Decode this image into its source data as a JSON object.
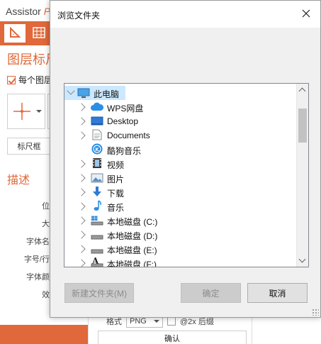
{
  "app": {
    "title_prefix": "Assistor ",
    "title_accent": "P",
    "layers_title": "图层标尺",
    "each_layer_label": "每个图层",
    "ruler_button": "标尺框",
    "desc_title": "描述",
    "props": [
      "位",
      "大",
      "字体名",
      "字号/行",
      "字体颜",
      "效"
    ],
    "format_label": "格式",
    "format_value": "PNG",
    "suffix_label": "@2x 后缀",
    "confirm_label": "确认",
    "accent_color": "#e0683a"
  },
  "dialog": {
    "title": "浏览文件夹",
    "tree": {
      "root": {
        "label": "此电脑",
        "icon": "computer-icon"
      },
      "items": [
        {
          "label": "WPS网盘",
          "icon": "cloud-icon"
        },
        {
          "label": "Desktop",
          "icon": "desktop-icon"
        },
        {
          "label": "Documents",
          "icon": "document-icon"
        },
        {
          "label": "酷狗音乐",
          "icon": "kugou-icon"
        },
        {
          "label": "视频",
          "icon": "video-icon"
        },
        {
          "label": "图片",
          "icon": "pictures-icon"
        },
        {
          "label": "下载",
          "icon": "download-icon"
        },
        {
          "label": "音乐",
          "icon": "music-icon"
        },
        {
          "label": "本地磁盘 (C:)",
          "icon": "windows-drive-icon"
        },
        {
          "label": "本地磁盘 (D:)",
          "icon": "drive-icon"
        },
        {
          "label": "本地磁盘 (E:)",
          "icon": "drive-icon"
        },
        {
          "label": "本地磁盘 (F:)",
          "icon": "font-drive-icon"
        }
      ]
    },
    "buttons": {
      "new_folder": "新建文件夹(M)",
      "ok": "确定",
      "cancel": "取消"
    }
  }
}
